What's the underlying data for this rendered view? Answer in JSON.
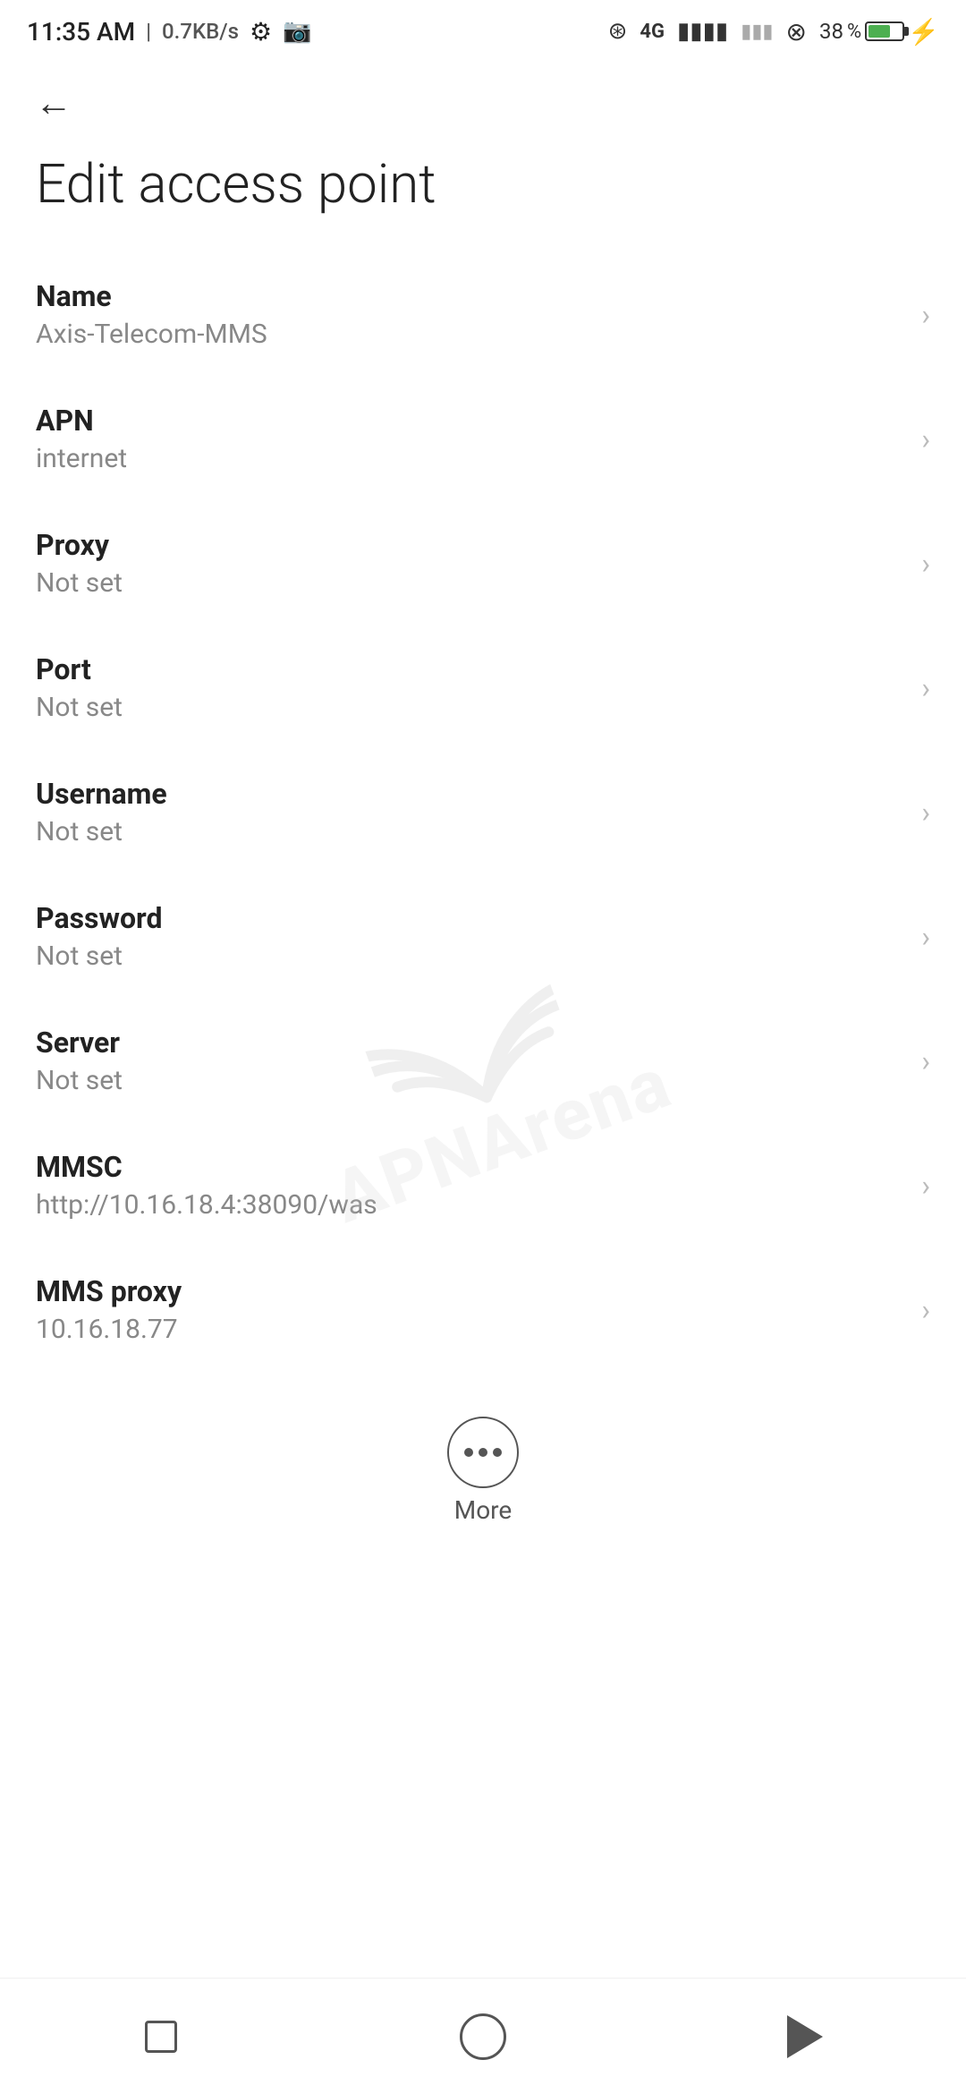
{
  "statusBar": {
    "time": "11:35 AM",
    "networkSpeed": "0.7KB/s",
    "batteryPercent": "38"
  },
  "nav": {
    "backLabel": "←"
  },
  "page": {
    "title": "Edit access point"
  },
  "settings": [
    {
      "label": "Name",
      "value": "Axis-Telecom-MMS"
    },
    {
      "label": "APN",
      "value": "internet"
    },
    {
      "label": "Proxy",
      "value": "Not set"
    },
    {
      "label": "Port",
      "value": "Not set"
    },
    {
      "label": "Username",
      "value": "Not set"
    },
    {
      "label": "Password",
      "value": "Not set"
    },
    {
      "label": "Server",
      "value": "Not set"
    },
    {
      "label": "MMSC",
      "value": "http://10.16.18.4:38090/was"
    },
    {
      "label": "MMS proxy",
      "value": "10.16.18.77"
    }
  ],
  "more": {
    "label": "More"
  },
  "bottomNav": {
    "square": "recent-apps",
    "circle": "home",
    "triangle": "back"
  }
}
